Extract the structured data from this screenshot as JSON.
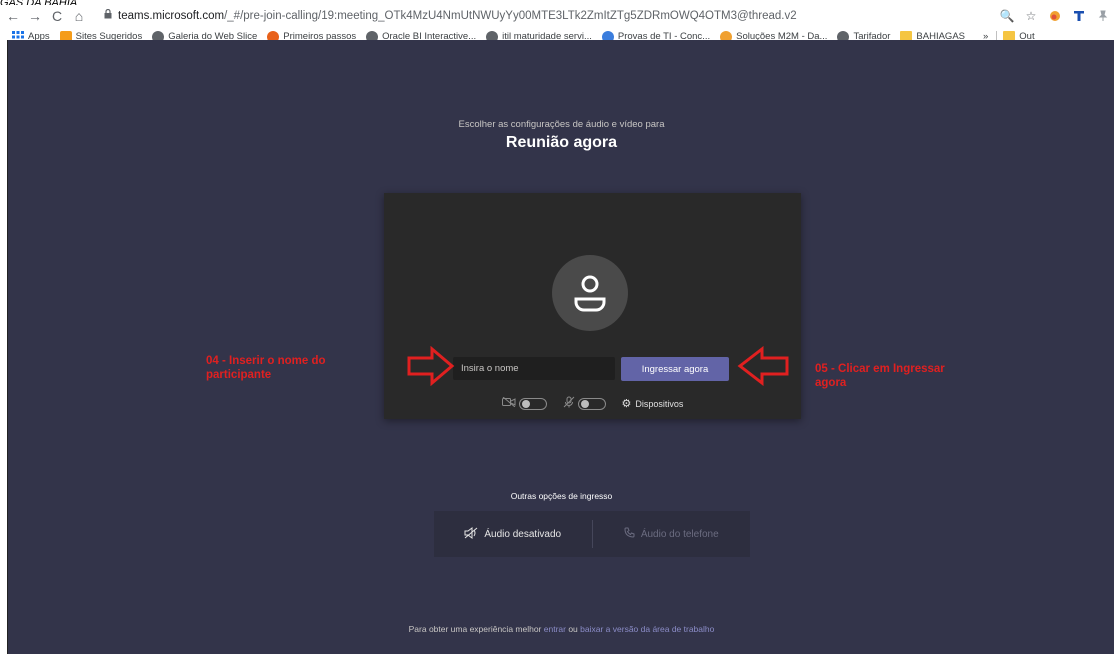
{
  "caption": "GÁS DA BAHIA",
  "browser": {
    "url_host": "teams.microsoft.com",
    "url_path": "/_#/pre-join-calling/19:meeting_OTk4MzU4NmUtNWUyYy00MTE3LTk2ZmItZTg5ZDRmOWQ4OTM3@thread.v2",
    "nav": {
      "back": "←",
      "forward": "→",
      "reload": "C",
      "home": "⌂",
      "lock": "🔒"
    },
    "bar_icons": [
      "🔍",
      "☆"
    ]
  },
  "bookmarks": [
    {
      "label": "Apps",
      "icon": "apps-grid-icon",
      "color": "#1a73e8"
    },
    {
      "label": "Sites Sugeridos",
      "icon": "sites-icon",
      "color": "#f59c1a"
    },
    {
      "label": "Galeria do Web Slice",
      "icon": "globe-icon",
      "color": "#5f6368"
    },
    {
      "label": "Primeiros passos",
      "icon": "firefox-icon",
      "color": "#e8611a"
    },
    {
      "label": "Oracle BI Interactive...",
      "icon": "globe-icon",
      "color": "#5f6368"
    },
    {
      "label": "itil maturidade servi...",
      "icon": "globe-icon",
      "color": "#5f6368"
    },
    {
      "label": "Provas de TI - Conc...",
      "icon": "provas-icon",
      "color": "#3b7ddd"
    },
    {
      "label": "Soluções M2M - Da...",
      "icon": "m2m-icon",
      "color": "#f0a030"
    },
    {
      "label": "Tarifador",
      "icon": "globe-icon",
      "color": "#5f6368"
    },
    {
      "label": "BAHIAGAS",
      "icon": "folder-icon",
      "color": "#f5c542"
    },
    {
      "label": "»",
      "icon": "",
      "color": ""
    },
    {
      "label": "Out",
      "icon": "folder-icon",
      "color": "#f5c542"
    }
  ],
  "prejoin": {
    "subtitle": "Escolher as configurações de áudio e vídeo para",
    "title": "Reunião agora",
    "name_placeholder": "Insira o nome",
    "join_label": "Ingressar agora",
    "devices_label": "Dispositivos",
    "camera_on": false,
    "mic_on": false
  },
  "annotations": {
    "left": "04 - Inserir o nome do participante",
    "right": "05 - Clicar em Ingressar agora"
  },
  "other_options": {
    "label": "Outras opções de ingresso",
    "audio_off": "Áudio desativado",
    "phone_audio": "Áudio do telefone"
  },
  "footer": {
    "prefix": "Para obter uma experiência melhor ",
    "link1": "entrar",
    "middle": " ou ",
    "link2": "baixar a versão da área de trabalho"
  },
  "colors": {
    "background": "#33344a",
    "card": "#292929",
    "accent": "#6264a7",
    "annotation": "#e02020"
  }
}
